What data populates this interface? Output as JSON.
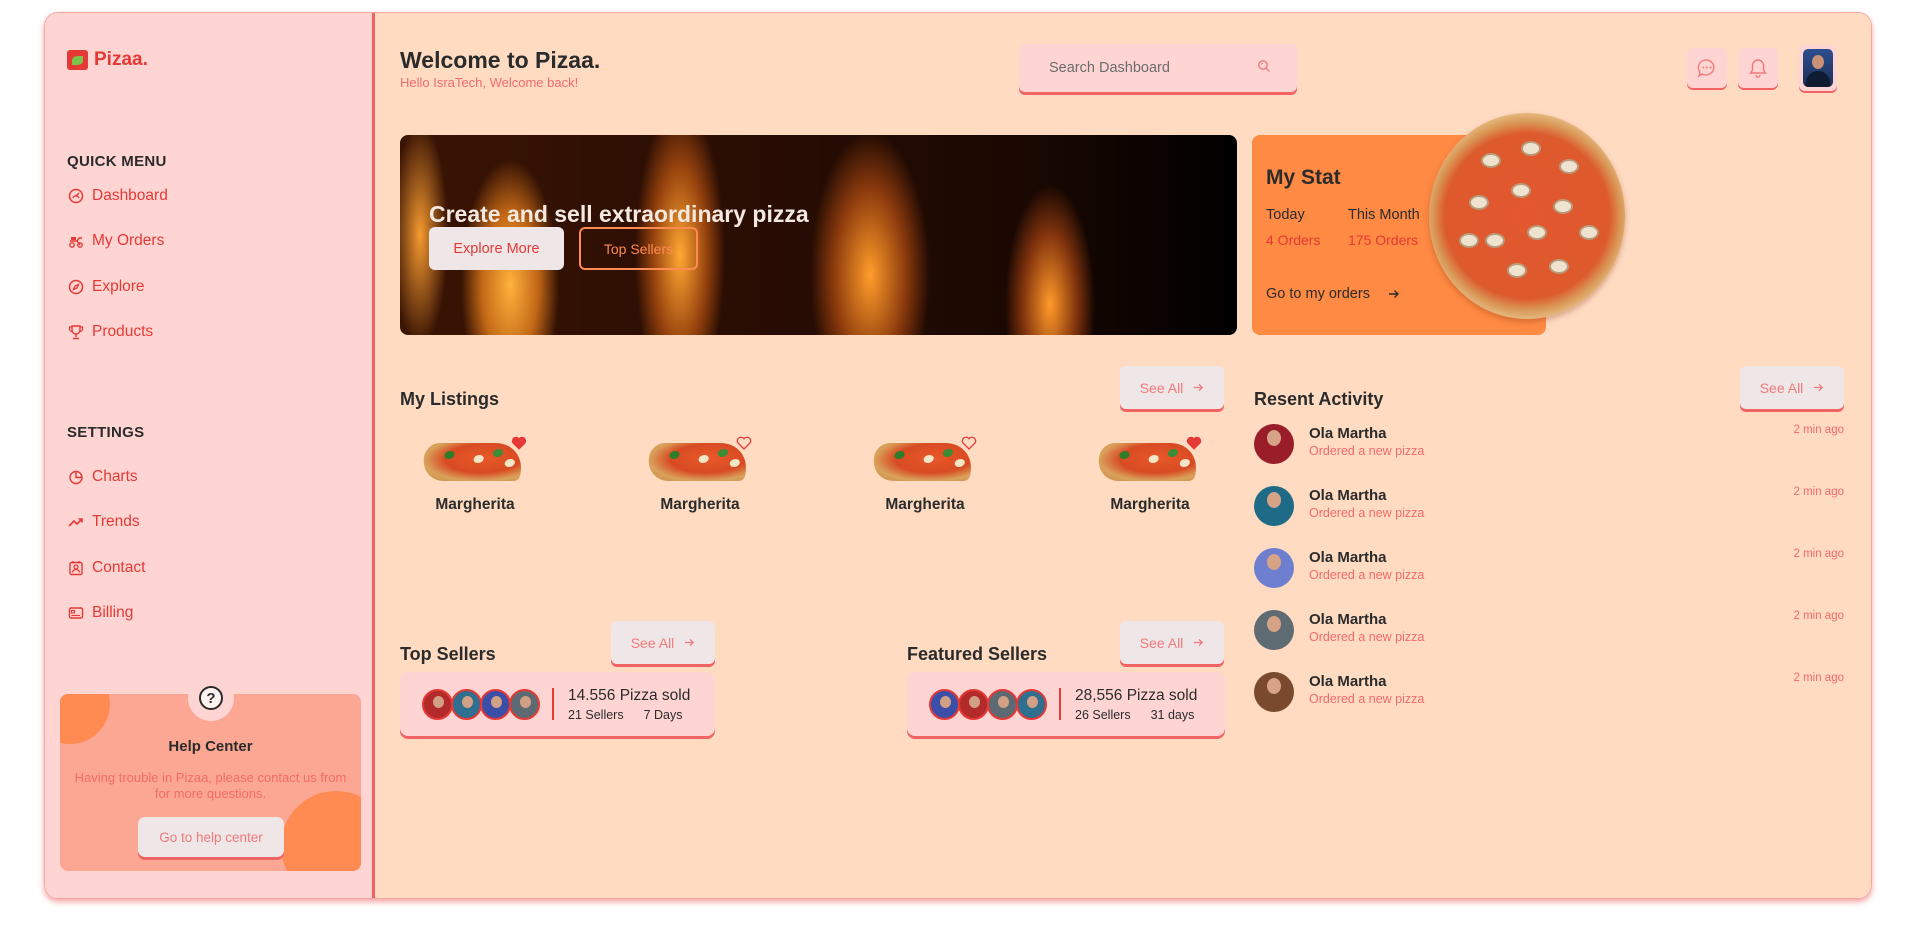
{
  "brand": {
    "name": "Pizaa."
  },
  "sidebar": {
    "quick_menu_title": "QUICK MENU",
    "quick_items": [
      {
        "label": "Dashboard",
        "icon": "dashboard-icon"
      },
      {
        "label": "My Orders",
        "icon": "orders-icon"
      },
      {
        "label": "Explore",
        "icon": "compass-icon"
      },
      {
        "label": "Products",
        "icon": "trophy-icon"
      }
    ],
    "settings_title": "SETTINGS",
    "settings_items": [
      {
        "label": "Charts",
        "icon": "pie-chart-icon"
      },
      {
        "label": "Trends",
        "icon": "trend-icon"
      },
      {
        "label": "Contact",
        "icon": "contact-icon"
      },
      {
        "label": "Billing",
        "icon": "billing-icon"
      }
    ],
    "help": {
      "title": "Help Center",
      "text": "Having trouble in Pizaa, please contact us from for more questions.",
      "button": "Go to help center"
    }
  },
  "header": {
    "title": "Welcome to Pizaa.",
    "subtitle": "Hello IsraTech, Welcome back!",
    "search_placeholder": "Search Dashboard"
  },
  "hero": {
    "title": "Create and sell extraordinary pizza",
    "primary_button": "Explore More",
    "secondary_button": "Top Sellers"
  },
  "stat": {
    "title": "My Stat",
    "today_label": "Today",
    "today_value": "4 Orders",
    "month_label": "This Month",
    "month_value": "175 Orders",
    "link": "Go to my orders"
  },
  "listings": {
    "title": "My Listings",
    "see_all": "See All",
    "items": [
      {
        "name": "Margherita",
        "favorited": true
      },
      {
        "name": "Margherita",
        "favorited": false
      },
      {
        "name": "Margherita",
        "favorited": false
      },
      {
        "name": "Margherita",
        "favorited": true
      }
    ]
  },
  "top_sellers": {
    "title": "Top Sellers",
    "see_all": "See All",
    "sold": "14.556 Pizza sold",
    "sellers": "21 Sellers",
    "period": "7 Days"
  },
  "featured_sellers": {
    "title": "Featured Sellers",
    "see_all": "See All",
    "sold": "28,556 Pizza sold",
    "sellers": "26 Sellers",
    "period": "31 days"
  },
  "activity": {
    "title": "Resent Activity",
    "see_all": "See All",
    "items": [
      {
        "name": "Ola Martha",
        "action": "Ordered a new pizza",
        "time": "2 min ago"
      },
      {
        "name": "Ola Martha",
        "action": "Ordered a new pizza",
        "time": "2 min ago"
      },
      {
        "name": "Ola Martha",
        "action": "Ordered a new pizza",
        "time": "2 min ago"
      },
      {
        "name": "Ola Martha",
        "action": "Ordered a new pizza",
        "time": "2 min ago"
      },
      {
        "name": "Ola Martha",
        "action": "Ordered a new pizza",
        "time": "2 min ago"
      }
    ]
  },
  "colors": {
    "accent": "#e53935",
    "orange": "#ff8a43",
    "sidebar_bg": "#ffd5d3",
    "main_bg": "#ffdbc2"
  }
}
